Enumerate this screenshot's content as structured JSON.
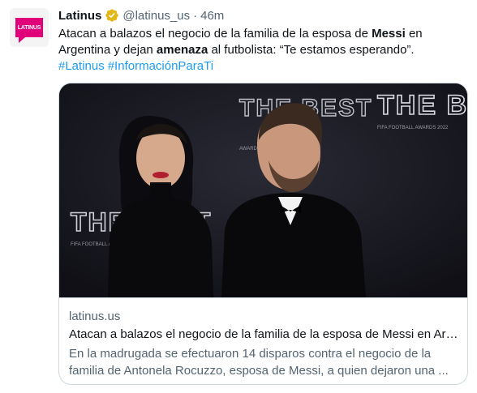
{
  "account": {
    "avatar_label": "LATINUS",
    "name": "Latinus",
    "handle": "@latinus_us",
    "separator": "·",
    "time": "46m"
  },
  "tweet": {
    "text_part1": "Atacan a balazos el negocio de la familia de la esposa de ",
    "text_bold1": "Messi",
    "text_part2": " en Argentina y dejan ",
    "text_bold2": "amenaza",
    "text_part3": " al futbolista: “Te estamos esperando”.",
    "hashtags": [
      "#Latinus",
      "#InformaciónParaTi"
    ]
  },
  "card": {
    "image": {
      "backdrop_logo": "THE BEST",
      "backdrop_sub": "FIFA FOOTBALL AWARDS 2022",
      "backdrop_sub_short": "FIFA FOOTBALL AWARDS",
      "backdrop_sub_year": "AWARDS 2022"
    },
    "domain": "latinus.us",
    "title": "Atacan a balazos el negocio de la familia de la esposa de Messi en Argentina y dejan amenaza al futbolista: “Te estamos esperando”",
    "description": "En la madrugada se efectuaron 14 disparos contra el negocio de la familia de Antonela Rocuzzo, esposa de Messi, a quien dejaron una ..."
  },
  "colors": {
    "brand": "#e0007a",
    "link": "#1d9bf0",
    "secondary_text": "#536471",
    "verified": "#e2b719"
  }
}
